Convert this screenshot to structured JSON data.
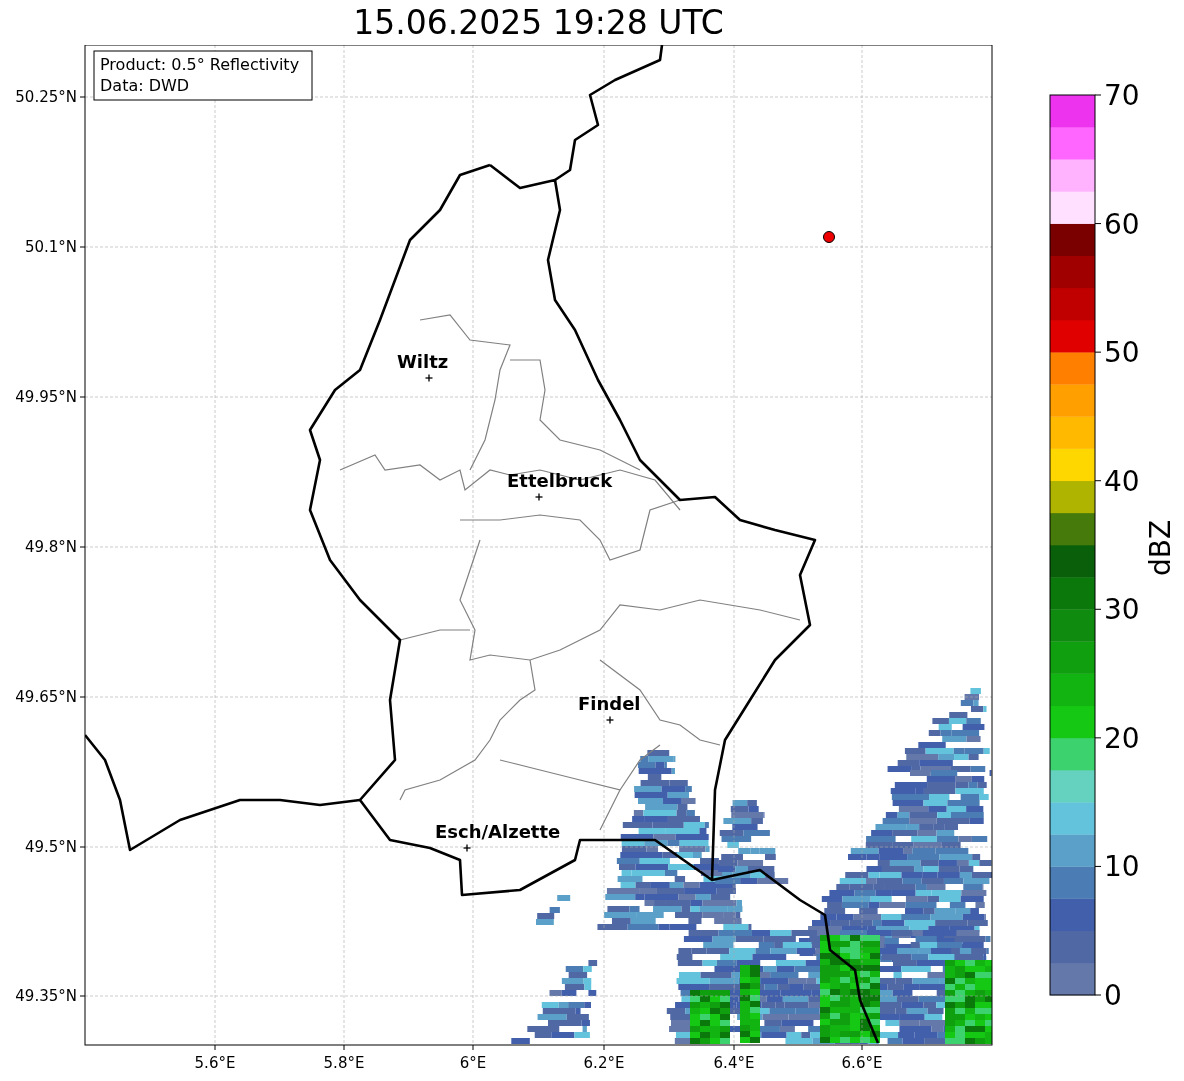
{
  "title": "15.06.2025 19:28 UTC",
  "info_box": [
    "Product: 0.5° Reflectivity",
    "Data: DWD"
  ],
  "lat_labels": [
    "50.25°N",
    "50.1°N",
    "49.95°N",
    "49.8°N",
    "49.65°N",
    "49.5°N",
    "49.35°N"
  ],
  "lon_labels": [
    "5.6°E",
    "5.8°E",
    "6°E",
    "6.2°E",
    "6.4°E",
    "6.6°E"
  ],
  "cities": [
    {
      "name": "Wiltz"
    },
    {
      "name": "Ettelbruck"
    },
    {
      "name": "Findel"
    },
    {
      "name": "Esch/Alzette"
    }
  ],
  "colorbar": {
    "label": "dBZ",
    "ticks": [
      "70",
      "60",
      "50",
      "40",
      "30",
      "20",
      "10",
      "0"
    ],
    "segments": [
      {
        "color": "#6478aa"
      },
      {
        "color": "#5069a5"
      },
      {
        "color": "#415faa"
      },
      {
        "color": "#4b7db4"
      },
      {
        "color": "#5aa0c8"
      },
      {
        "color": "#64c3dc"
      },
      {
        "color": "#64d2be"
      },
      {
        "color": "#3cd26e"
      },
      {
        "color": "#14c814"
      },
      {
        "color": "#12b412"
      },
      {
        "color": "#0f9f0f"
      },
      {
        "color": "#0f8c0f"
      },
      {
        "color": "#0a780a"
      },
      {
        "color": "#0a5f0a"
      },
      {
        "color": "#467a0a"
      },
      {
        "color": "#afb400"
      },
      {
        "color": "#ffd700"
      },
      {
        "color": "#ffba00"
      },
      {
        "color": "#ff9f00"
      },
      {
        "color": "#ff7f00"
      },
      {
        "color": "#e00000"
      },
      {
        "color": "#c00000"
      },
      {
        "color": "#a00000"
      },
      {
        "color": "#7a0000"
      },
      {
        "color": "#ffe0ff"
      },
      {
        "color": "#ffb3ff"
      },
      {
        "color": "#ff66ff"
      },
      {
        "color": "#ee33ee"
      }
    ]
  }
}
